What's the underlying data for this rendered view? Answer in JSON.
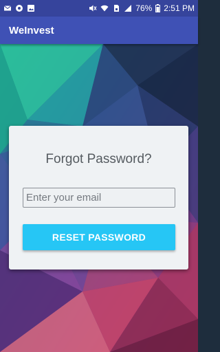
{
  "status_bar": {
    "battery": "76%",
    "time": "2:51 PM"
  },
  "app": {
    "title": "WeInvest"
  },
  "card": {
    "title": "Forgot Password?",
    "email_placeholder": "Enter your email",
    "email_value": "",
    "reset_label": "RESET PASSWORD"
  },
  "colors": {
    "app_bar": "#3f51b5",
    "status_bar": "#36449c",
    "button": "#26c6f5",
    "card": "#eff2f4"
  }
}
